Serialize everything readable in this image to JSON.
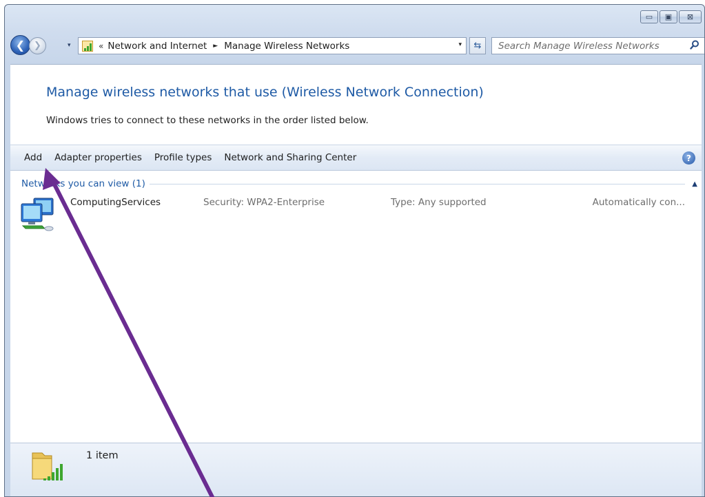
{
  "window": {
    "caption_buttons": {
      "minimize": "▭",
      "maximize": "▣",
      "close": "⊠"
    }
  },
  "navigation": {
    "back_icon": "back-arrow-icon",
    "forward_icon": "forward-arrow-icon",
    "recent_icon": "▾",
    "address": {
      "prefix": "«",
      "breadcrumbs": [
        "Network and Internet",
        "Manage Wireless Networks"
      ],
      "separator": "►",
      "dropdown": "▾"
    },
    "refresh_symbol": "⇆",
    "search": {
      "placeholder": "Search Manage Wireless Networks"
    }
  },
  "main": {
    "heading": "Manage wireless networks that use (Wireless Network Connection)",
    "subtext": "Windows tries to connect to these networks in the order listed below."
  },
  "command_bar": {
    "items": [
      "Add",
      "Adapter properties",
      "Profile types",
      "Network and Sharing Center"
    ],
    "help": "?"
  },
  "group": {
    "label": "Networks you can view (1)",
    "collapse_symbol": "▲"
  },
  "networks": [
    {
      "name": "ComputingServices",
      "security": "Security: WPA2-Enterprise",
      "type": "Type: Any supported",
      "mode": "Automatically con..."
    }
  ],
  "details": {
    "count_text": "1 item"
  },
  "colors": {
    "heading_blue": "#1e5aa5",
    "annotation_purple": "#6a2c91",
    "signal_green": "#3ea62e"
  }
}
